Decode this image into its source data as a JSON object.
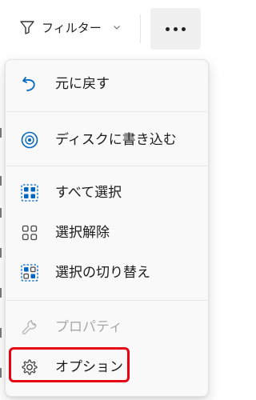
{
  "toolbar": {
    "filter_label": "フィルター",
    "filter_icon": "filter-icon",
    "more_icon": "more-options-icon"
  },
  "menu": {
    "items": [
      {
        "label": "元に戻す",
        "icon": "undo-icon",
        "enabled": true
      },
      {
        "label": "ディスクに書き込む",
        "icon": "burn-disc-icon",
        "enabled": true
      },
      {
        "label": "すべて選択",
        "icon": "select-all-icon",
        "enabled": true
      },
      {
        "label": "選択解除",
        "icon": "select-none-icon",
        "enabled": true
      },
      {
        "label": "選択の切り替え",
        "icon": "invert-selection-icon",
        "enabled": true
      },
      {
        "label": "プロパティ",
        "icon": "properties-icon",
        "enabled": false
      },
      {
        "label": "オプション",
        "icon": "gear-icon",
        "enabled": true,
        "highlighted": true
      }
    ]
  },
  "colors": {
    "accent": "#0067c0",
    "highlight": "#e60012",
    "disabled": "#a8a8a8"
  }
}
